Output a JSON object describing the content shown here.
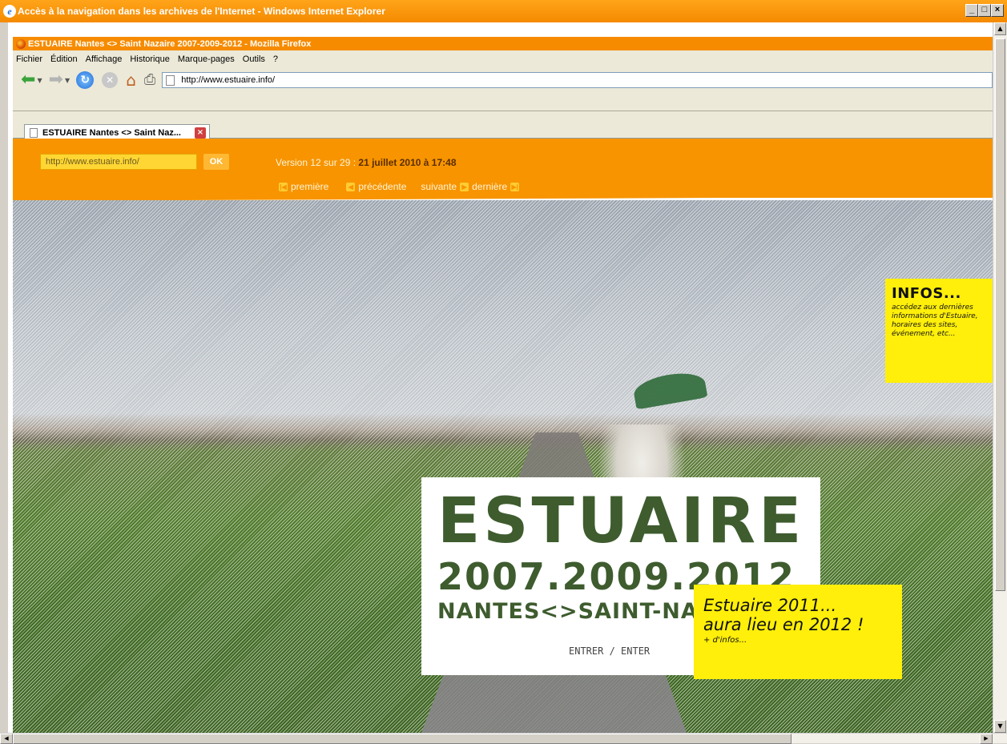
{
  "ie_window": {
    "title": "Accès à la navigation dans les archives de l'Internet - Windows Internet Explorer",
    "controls": [
      "_",
      "□",
      "×"
    ]
  },
  "firefox": {
    "title": "ESTUAIRE Nantes <> Saint Nazaire 2007-2009-2012 - Mozilla Firefox",
    "menu": [
      "Fichier",
      "Édition",
      "Affichage",
      "Historique",
      "Marque-pages",
      "Outils",
      "?"
    ],
    "url": "http://www.estuaire.info/",
    "tab_label": "ESTUAIRE Nantes <> Saint Naz..."
  },
  "wayback": {
    "url_input": "http://www.estuaire.info/",
    "ok_label": "OK",
    "version_prefix": "Version 12 sur 29 : ",
    "version_date": "21 juillet 2010 à 17:48",
    "nav": {
      "first": "première",
      "previous": "précédente",
      "next": "suivante",
      "last": "dernière"
    }
  },
  "site": {
    "infos": {
      "title": "INFOS...",
      "text": "accédez aux dernières informations d'Estuaire, horaires des sites, événement, etc..."
    },
    "logo": {
      "name": "ESTUAIRE",
      "years": "2007.2009.2012",
      "cities": "NANTES<>SAINT-NAZAIRE",
      "enter": "ENTRER / ENTER"
    },
    "promo": {
      "line1": "Estuaire 2011...",
      "line2": "aura lieu en 2012 !",
      "more": "+ d'infos..."
    }
  }
}
